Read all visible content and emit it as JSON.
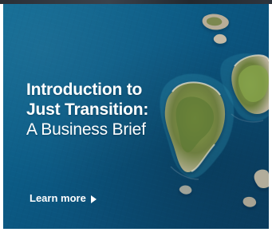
{
  "ad": {
    "headline": {
      "line1": "Introduction to",
      "line2": "Just Transition:",
      "line3": "A Business Brief"
    },
    "cta": {
      "label": "Learn more"
    }
  },
  "colors": {
    "ocean_deep": "#0a3f63",
    "ocean_mid": "#0b5c86",
    "island_rock": "#c9c1ae",
    "island_green": "#6f8f3f",
    "text": "#ffffff"
  },
  "icons": {
    "cta_arrow": "triangle-right-icon"
  }
}
